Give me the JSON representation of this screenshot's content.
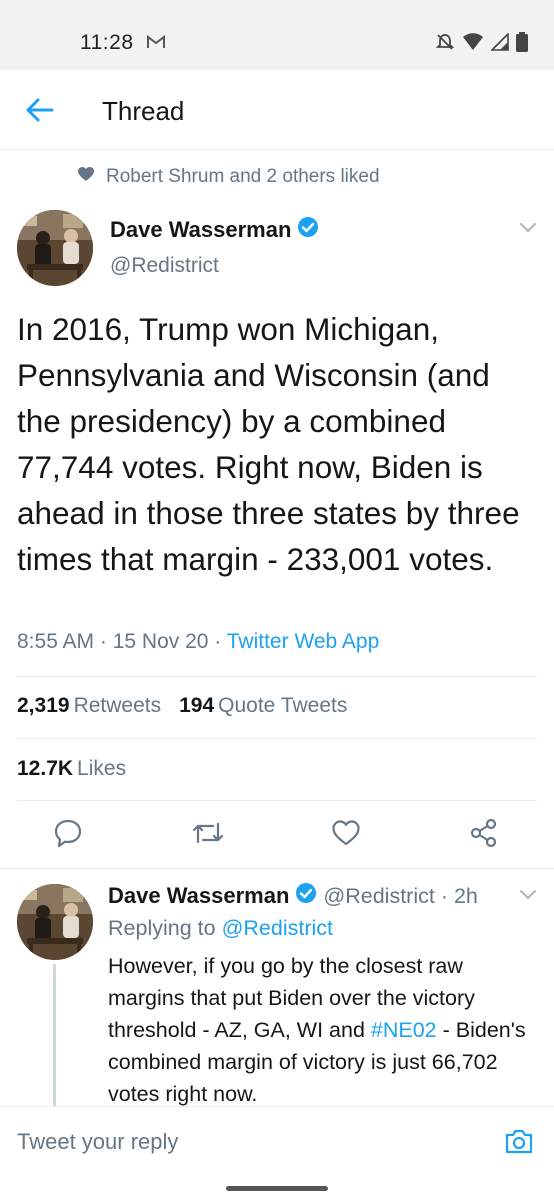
{
  "status_bar": {
    "time": "11:28",
    "icons": [
      "gmail-icon",
      "bell-off-icon",
      "wifi-icon",
      "signal-icon",
      "battery-icon"
    ]
  },
  "header": {
    "title": "Thread"
  },
  "social_context": {
    "text": "Robert Shrum and 2 others liked"
  },
  "tweet": {
    "author_name": "Dave Wasserman",
    "author_handle": "@Redistrict",
    "text": "In 2016, Trump won Michigan, Pennsylvania and Wisconsin (and the presidency) by a combined 77,744 votes. Right now, Biden is ahead in those three states by three times that margin - 233,001 votes.",
    "time": "8:55 AM",
    "date": "15 Nov 20",
    "source": "Twitter Web App",
    "separator": " · ",
    "retweets_count": "2,319",
    "retweets_label": "Retweets",
    "quotes_count": "194",
    "quotes_label": "Quote Tweets",
    "likes_count": "12.7K",
    "likes_label": "Likes"
  },
  "reply": {
    "author_name": "Dave Wasserman",
    "author_handle": "@Redistrict",
    "time_ago": "· 2h",
    "replying_prefix": "Replying to",
    "replying_to": "@Redistrict",
    "text_before": "However, if you go by the closest raw margins that put Biden over the victory threshold - AZ, GA, WI and ",
    "hashtag": "#NE02",
    "text_after": " - Biden's combined margin of victory is just 66,702 votes right now."
  },
  "reply_bar": {
    "placeholder": "Tweet your reply"
  },
  "colors": {
    "accent": "#1da1f2",
    "muted": "#657786",
    "text": "#14171a",
    "divider": "#e6ecf0"
  }
}
